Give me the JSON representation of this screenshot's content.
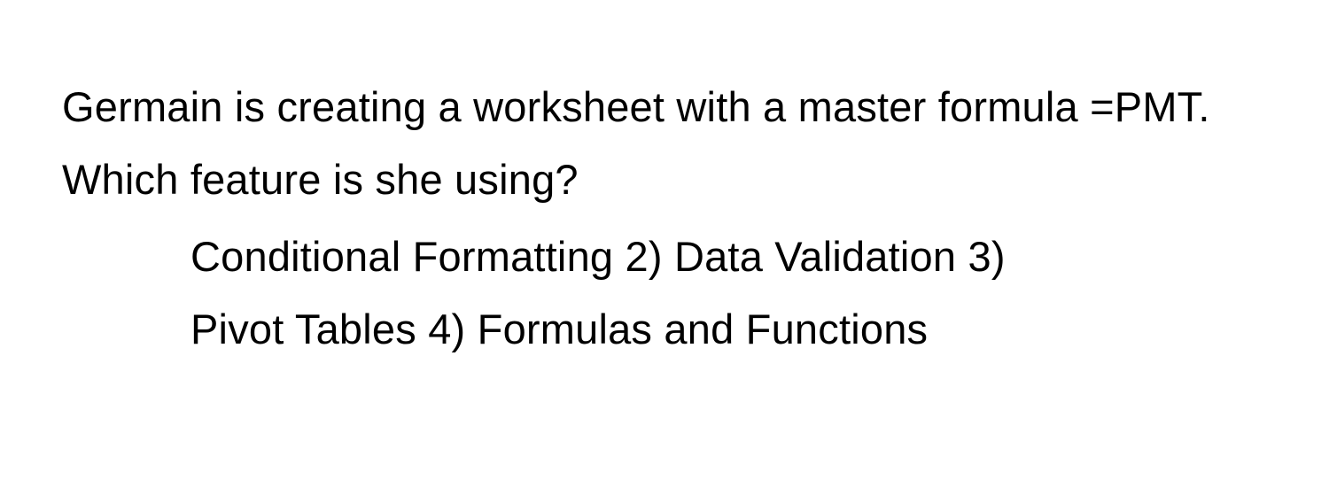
{
  "question": {
    "prompt": "Germain is creating a worksheet with a master formula =PMT. Which feature is she using?",
    "options_line1": "Conditional Formatting 2) Data Validation 3)",
    "options_line2": "Pivot Tables 4) Formulas and Functions"
  }
}
